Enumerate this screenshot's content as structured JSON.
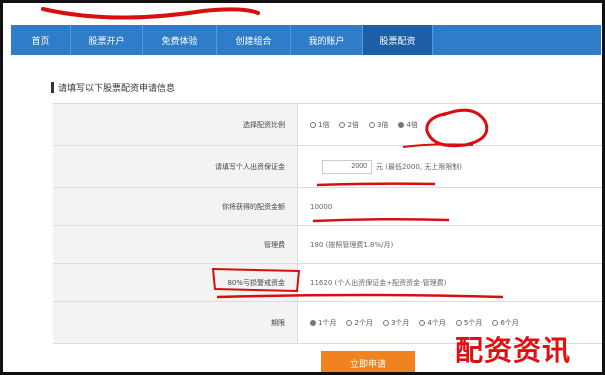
{
  "nav": {
    "items": [
      "首页",
      "股票开户",
      "免费体验",
      "创建组合",
      "我的账户",
      "股票配资"
    ],
    "active_index": 5
  },
  "form": {
    "heading": "请填写以下股票配资申请信息",
    "rows": {
      "multiple": {
        "label": "选择配资比例",
        "options": [
          "1倍",
          "2倍",
          "3倍",
          "4倍"
        ],
        "selected_index": 3
      },
      "deposit": {
        "label": "请填写个人出资保证金",
        "value": "2000",
        "hint": "元 (最低2000, 无上限限制)"
      },
      "amount": {
        "label": "你将获得的配资金额",
        "value": "10000"
      },
      "fee": {
        "label": "管理费",
        "value": "180 (按照管理费1.8%/月)"
      },
      "warning": {
        "label": "80%亏损警戒资金",
        "value": "11620 (个人出资保证金+配资资金-管理费)"
      },
      "period": {
        "label": "期限",
        "options": [
          "1个月",
          "2个月",
          "3个月",
          "4个月",
          "5个月",
          "6个月"
        ],
        "selected_index": 0
      }
    },
    "submit_label": "立即申请"
  },
  "watermark": "配资资讯",
  "colors": {
    "nav_bg": "#2f7dc9",
    "nav_active": "#1d5fa6",
    "button": "#f0831f",
    "annotation": "#d80f0f"
  }
}
